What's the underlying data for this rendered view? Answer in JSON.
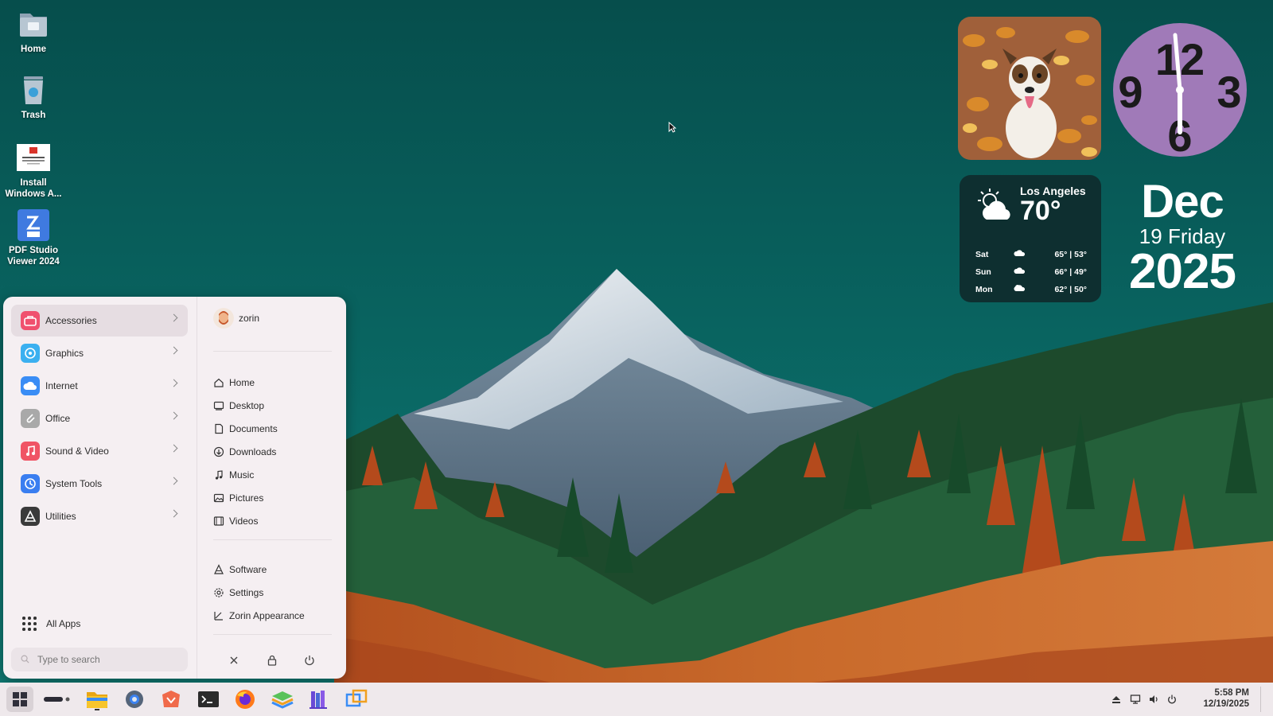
{
  "desktop": {
    "icons": [
      {
        "label": "Home"
      },
      {
        "label": "Trash"
      },
      {
        "label": "Install Windows A..."
      },
      {
        "label": "PDF Studio Viewer 2024"
      }
    ]
  },
  "widgets": {
    "clock": {
      "numerals": [
        "12",
        "3",
        "6",
        "9"
      ]
    },
    "weather": {
      "city": "Los Angeles",
      "temp": "70°",
      "forecast": [
        {
          "day": "Sat",
          "range": "65° | 53°"
        },
        {
          "day": "Sun",
          "range": "66° | 49°"
        },
        {
          "day": "Mon",
          "range": "62° | 50°"
        }
      ]
    },
    "date": {
      "month": "Dec",
      "day": "19 Friday",
      "year": "2025"
    }
  },
  "start_menu": {
    "categories": [
      {
        "label": "Accessories",
        "color": "#f0506e"
      },
      {
        "label": "Graphics",
        "color": "#3bb0f0"
      },
      {
        "label": "Internet",
        "color": "#3a8df5"
      },
      {
        "label": "Office",
        "color": "#a9a9a9"
      },
      {
        "label": "Sound & Video",
        "color": "#f05465"
      },
      {
        "label": "System Tools",
        "color": "#3a7ef0"
      },
      {
        "label": "Utilities",
        "color": "#3a3a3a"
      }
    ],
    "all_apps": "All Apps",
    "search_placeholder": "Type to search",
    "user": "zorin",
    "places": [
      "Home",
      "Desktop",
      "Documents",
      "Downloads",
      "Music",
      "Pictures",
      "Videos"
    ],
    "system": [
      "Software",
      "Settings",
      "Zorin Appearance"
    ]
  },
  "taskbar": {
    "time": "5:58 PM",
    "date": "12/19/2025"
  }
}
